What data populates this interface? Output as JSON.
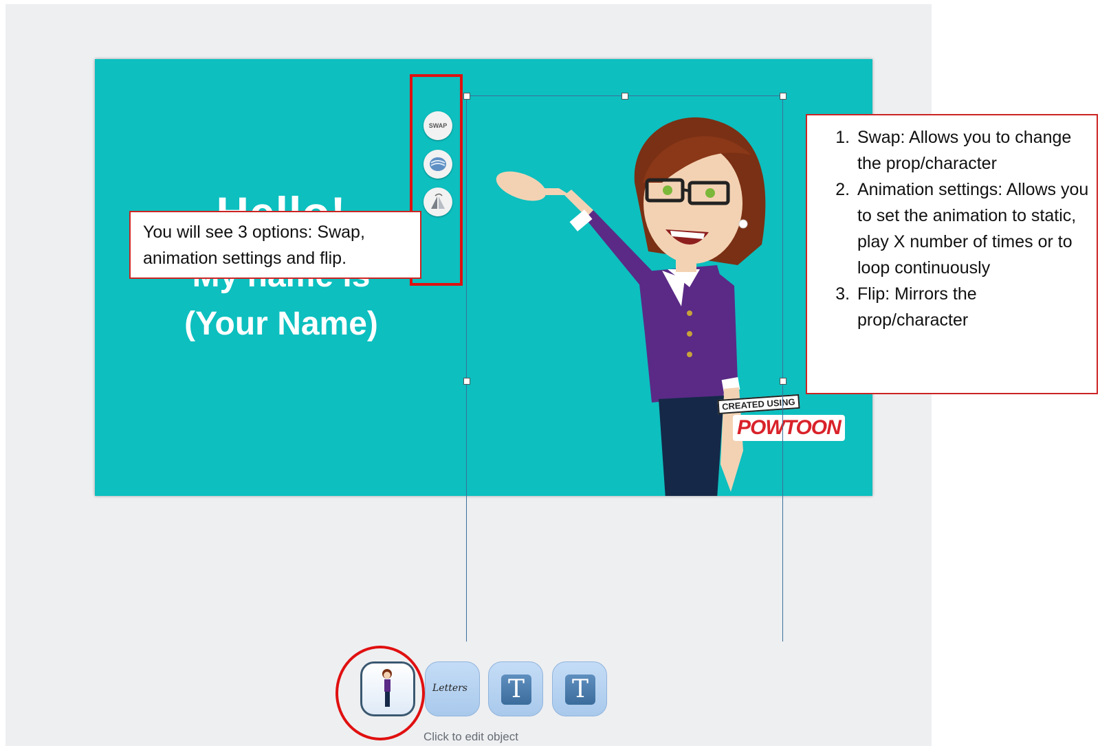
{
  "slide": {
    "hello": "Hello!",
    "my_name_is": "My name is",
    "your_name": "(Your Name)",
    "background_color": "#0dbfbf"
  },
  "toolbar": {
    "swap_label": "SWAP",
    "animation_icon": "animation-settings-icon",
    "flip_icon": "flip-icon"
  },
  "callout_left": {
    "text": "You will see 3 options: Swap, animation settings and flip."
  },
  "callout_right": {
    "items": [
      "Swap: Allows you to change the prop/character",
      "Animation settings: Allows you to set the animation to static, play X number of times or to loop continuously",
      "Flip: Mirrors the prop/character"
    ]
  },
  "watermark": {
    "created_using": "CREATED USING",
    "brand": "POWTOON"
  },
  "timeline": {
    "items": [
      {
        "type": "character",
        "label": ""
      },
      {
        "type": "text",
        "label": "Letters"
      },
      {
        "type": "text-icon",
        "label": "T"
      },
      {
        "type": "text-icon",
        "label": "T"
      }
    ],
    "caption": "Click to edit object"
  },
  "colors": {
    "annotation_red": "#e01010",
    "selection": "#3a6f9a"
  }
}
